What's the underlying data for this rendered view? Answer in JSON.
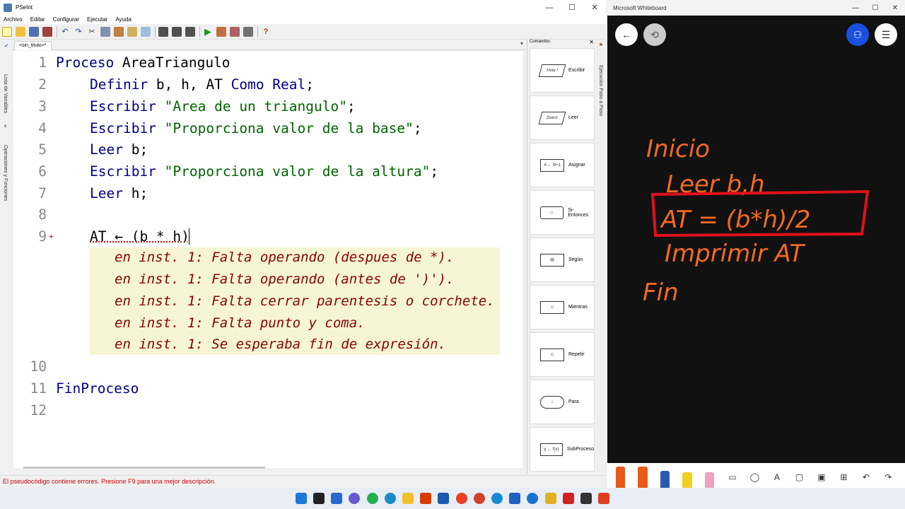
{
  "pseint": {
    "title": "PSeInt",
    "menu": [
      "Archivo",
      "Editar",
      "Configurar",
      "Ejecutar",
      "Ayuda"
    ],
    "tab_label": "<sin_titulo>*",
    "side_labels": [
      "Lista de Variables",
      "Operaciones y Funciones"
    ],
    "right_label": "Ejecución Paso a Paso",
    "commands_title": "Comandos",
    "commands": [
      {
        "label": "Escribir",
        "shape": "Hola !"
      },
      {
        "label": "Leer",
        "shape": "Dato1"
      },
      {
        "label": "Asignar",
        "shape": "A ← B+1"
      },
      {
        "label": "Si-Entonces",
        "shape": ""
      },
      {
        "label": "Según",
        "shape": ""
      },
      {
        "label": "Mientras",
        "shape": ""
      },
      {
        "label": "Repetir",
        "shape": ""
      },
      {
        "label": "Para",
        "shape": ""
      },
      {
        "label": "SubProceso",
        "shape": "y ← f(x)"
      }
    ],
    "line_numbers": [
      "1",
      "2",
      "3",
      "4",
      "5",
      "6",
      "7",
      "8",
      "9",
      "10",
      "11",
      "12"
    ],
    "code": {
      "l1_kw": "Proceso",
      "l1_name": " AreaTriangulo",
      "l2_kw": "Definir",
      "l2_vars": " b, h, AT ",
      "l2_kw2": "Como Real",
      "l2_end": ";",
      "l3_kw": "Escribir",
      "l3_str": " \"Area de un triangulo\"",
      "l3_end": ";",
      "l4_kw": "Escribir",
      "l4_str": " \"Proporciona valor de la base\"",
      "l4_end": ";",
      "l5_kw": "Leer",
      "l5_rest": " b;",
      "l6_kw": "Escribir",
      "l6_str": " \"Proporciona valor de la altura\"",
      "l6_end": ";",
      "l7_kw": "Leer",
      "l7_rest": " h;",
      "l9": "AT ← (b * h)",
      "l11_kw": "FinProceso"
    },
    "errors": [
      "en inst. 1: Falta operando (despues de *).",
      "en inst. 1: Falta operando (antes de ')').",
      "en inst. 1: Falta cerrar parentesis o corchete.",
      "en inst. 1: Falta punto y coma.",
      "en inst. 1: Se esperaba fin de expresión."
    ],
    "status": "El pseudocódigo contiene errores. Presione F9 para una mejor descripción."
  },
  "whiteboard": {
    "title": "Microsoft Whiteboard",
    "handwriting": [
      "Inicio",
      "Leer b,h",
      "AT = (b*h)/2",
      "Imprimir AT",
      "Fin"
    ],
    "ink_color": "#f26a21",
    "box_color": "#e0101a"
  }
}
